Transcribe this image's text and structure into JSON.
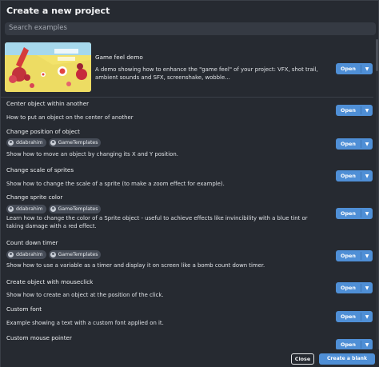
{
  "dialog": {
    "title": "Create a new project",
    "search_placeholder": "Search examples"
  },
  "featured": {
    "title": "Game feel demo",
    "description": "A demo showing how to enhance the \"game feel\" of your project: VFX, shot trail, ambient sounds and SFX, screenshake, wobble...",
    "open_label": "Open"
  },
  "examples": [
    {
      "title": "Center object within another",
      "description": "How to put an object on the center of another",
      "open_label": "Open"
    },
    {
      "title": "Change position of object",
      "tags": [
        "ddabrahim",
        "GameTemplates"
      ],
      "description": "Show how to move an object by changing its X and Y position.",
      "open_label": "Open"
    },
    {
      "title": "Change scale of sprites",
      "description": "Show how to change the scale of a sprite (to make a zoom effect for example).",
      "open_label": "Open"
    },
    {
      "title": "Change sprite color",
      "tags": [
        "ddabrahim",
        "GameTemplates"
      ],
      "description": "Learn how to change the color of a Sprite object - useful to achieve effects like invincibility with a blue tint or taking damage with a red effect.",
      "open_label": "Open"
    },
    {
      "title": "Count down timer",
      "tags": [
        "ddabrahim",
        "GameTemplates"
      ],
      "description": "Show how to use a variable as a timer and display it on screen like a bomb count down timer.",
      "open_label": "Open"
    },
    {
      "title": "Create object with mouseclick",
      "description": "Show how to create an object at the position of the click.",
      "open_label": "Open"
    },
    {
      "title": "Custom font",
      "description": "Example showing a text with a custom font applied on it.",
      "open_label": "Open"
    },
    {
      "title": "Custom mouse pointer",
      "open_label": "Open"
    }
  ],
  "footer": {
    "close_label": "Close",
    "create_blank_label": "Create a blank project"
  },
  "colors": {
    "background": "#262a31",
    "accent": "#4f8fd6"
  }
}
